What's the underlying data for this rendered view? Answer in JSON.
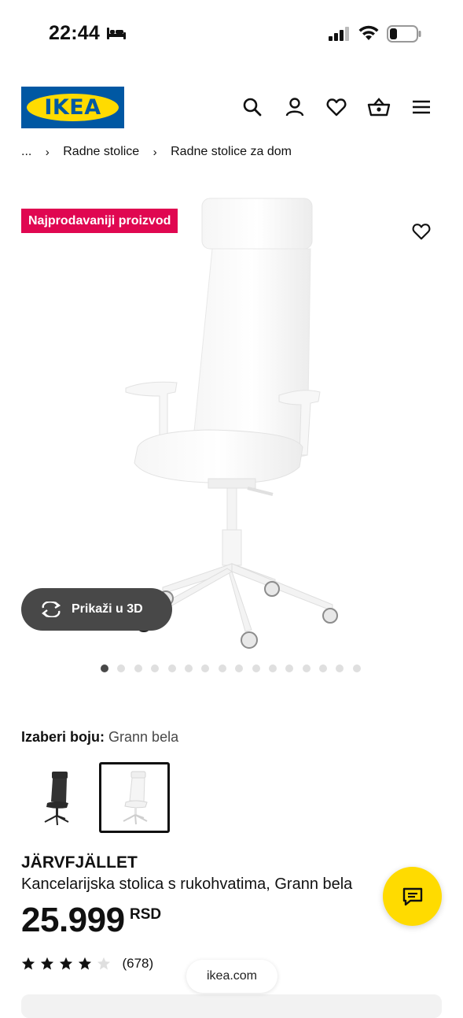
{
  "status_bar": {
    "time": "22:44"
  },
  "header": {
    "logo_text": "IKEA"
  },
  "breadcrumb": {
    "items": [
      "...",
      "Radne stolice",
      "Radne stolice za dom"
    ]
  },
  "gallery": {
    "badge": "Najprodavaniji proizvod",
    "view_3d_label": "Prikaži u 3D",
    "image_count": 16,
    "active_index": 0
  },
  "color_picker": {
    "label": "Izaberi boju:",
    "selected": "Grann bela",
    "options": [
      "black",
      "white"
    ]
  },
  "product": {
    "name": "JÄRVFJÄLLET",
    "description": "Kancelarijska stolica s rukohvatima, Grann bela",
    "price": "25.999",
    "currency": "RSD"
  },
  "rating": {
    "stars": 4,
    "max": 5,
    "count": "(678)"
  },
  "browser": {
    "url": "ikea.com"
  },
  "colors": {
    "brand_blue": "#0058a3",
    "brand_yellow": "#ffdb00",
    "badge_red": "#e00751"
  }
}
